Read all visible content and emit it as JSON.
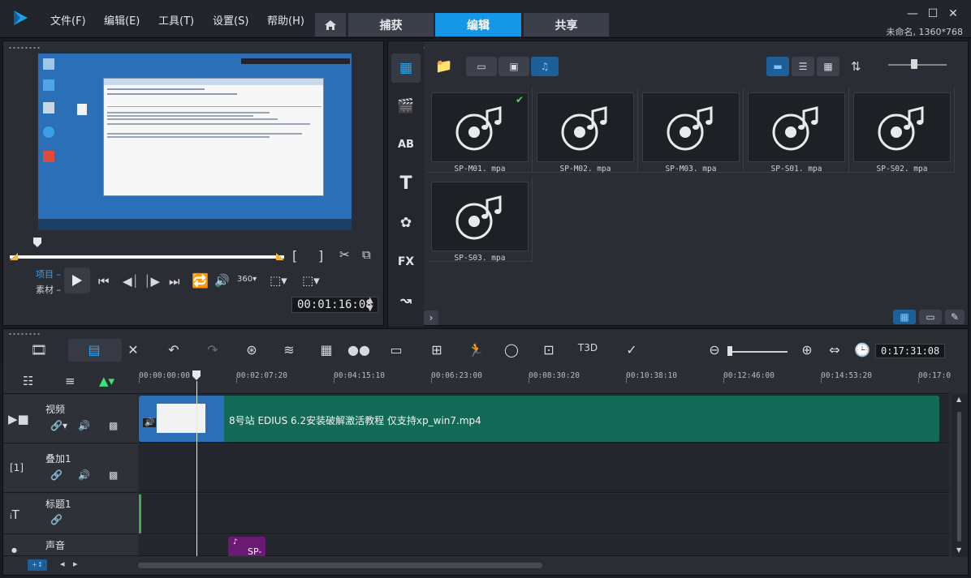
{
  "window": {
    "menu": [
      "文件(F)",
      "编辑(E)",
      "工具(T)",
      "设置(S)",
      "帮助(H)"
    ],
    "tabs": [
      "捕获",
      "编辑",
      "共享"
    ],
    "active_tab": "编辑",
    "project_info": "未命名, 1360*768",
    "accent": "#1697e5"
  },
  "preview": {
    "project_label": "项目",
    "clip_label": "素材",
    "timecode": "00:01:16:08",
    "scrub_position": 0.1,
    "mark_in": "[",
    "mark_out": "]"
  },
  "library": {
    "clips": [
      {
        "name": "SP-M01. mpa",
        "checked": true
      },
      {
        "name": "SP-M02. mpa",
        "checked": false
      },
      {
        "name": "SP-M03. mpa",
        "checked": false
      },
      {
        "name": "SP-S01. mpa",
        "checked": false
      },
      {
        "name": "SP-S02. mpa",
        "checked": false
      },
      {
        "name": "SP-S03. mpa",
        "checked": false
      }
    ]
  },
  "timeline": {
    "timecode": "0:17:31:08",
    "ruler": [
      "00:00:00:00",
      "00:02:07:20",
      "00:04:15:10",
      "00:06:23:00",
      "00:08:30:20",
      "00:10:38:10",
      "00:12:46:00",
      "00:14:53:20",
      "00:17:0"
    ],
    "tracks": [
      {
        "label": "视频",
        "icon": "video-track-icon"
      },
      {
        "label": "叠加1",
        "icon": "overlay-track-icon"
      },
      {
        "label": "标题1",
        "icon": "title-track-icon"
      },
      {
        "label": "声音",
        "icon": "voice-track-icon"
      }
    ],
    "video_clip_title": "8号站 EDIUS 6.2安装破解激活教程 仅支持xp_win7.mp4",
    "audio_clip_title": "SP-",
    "video_clip_color": "#136a57",
    "audio_clip_color": "#6b1a73"
  }
}
